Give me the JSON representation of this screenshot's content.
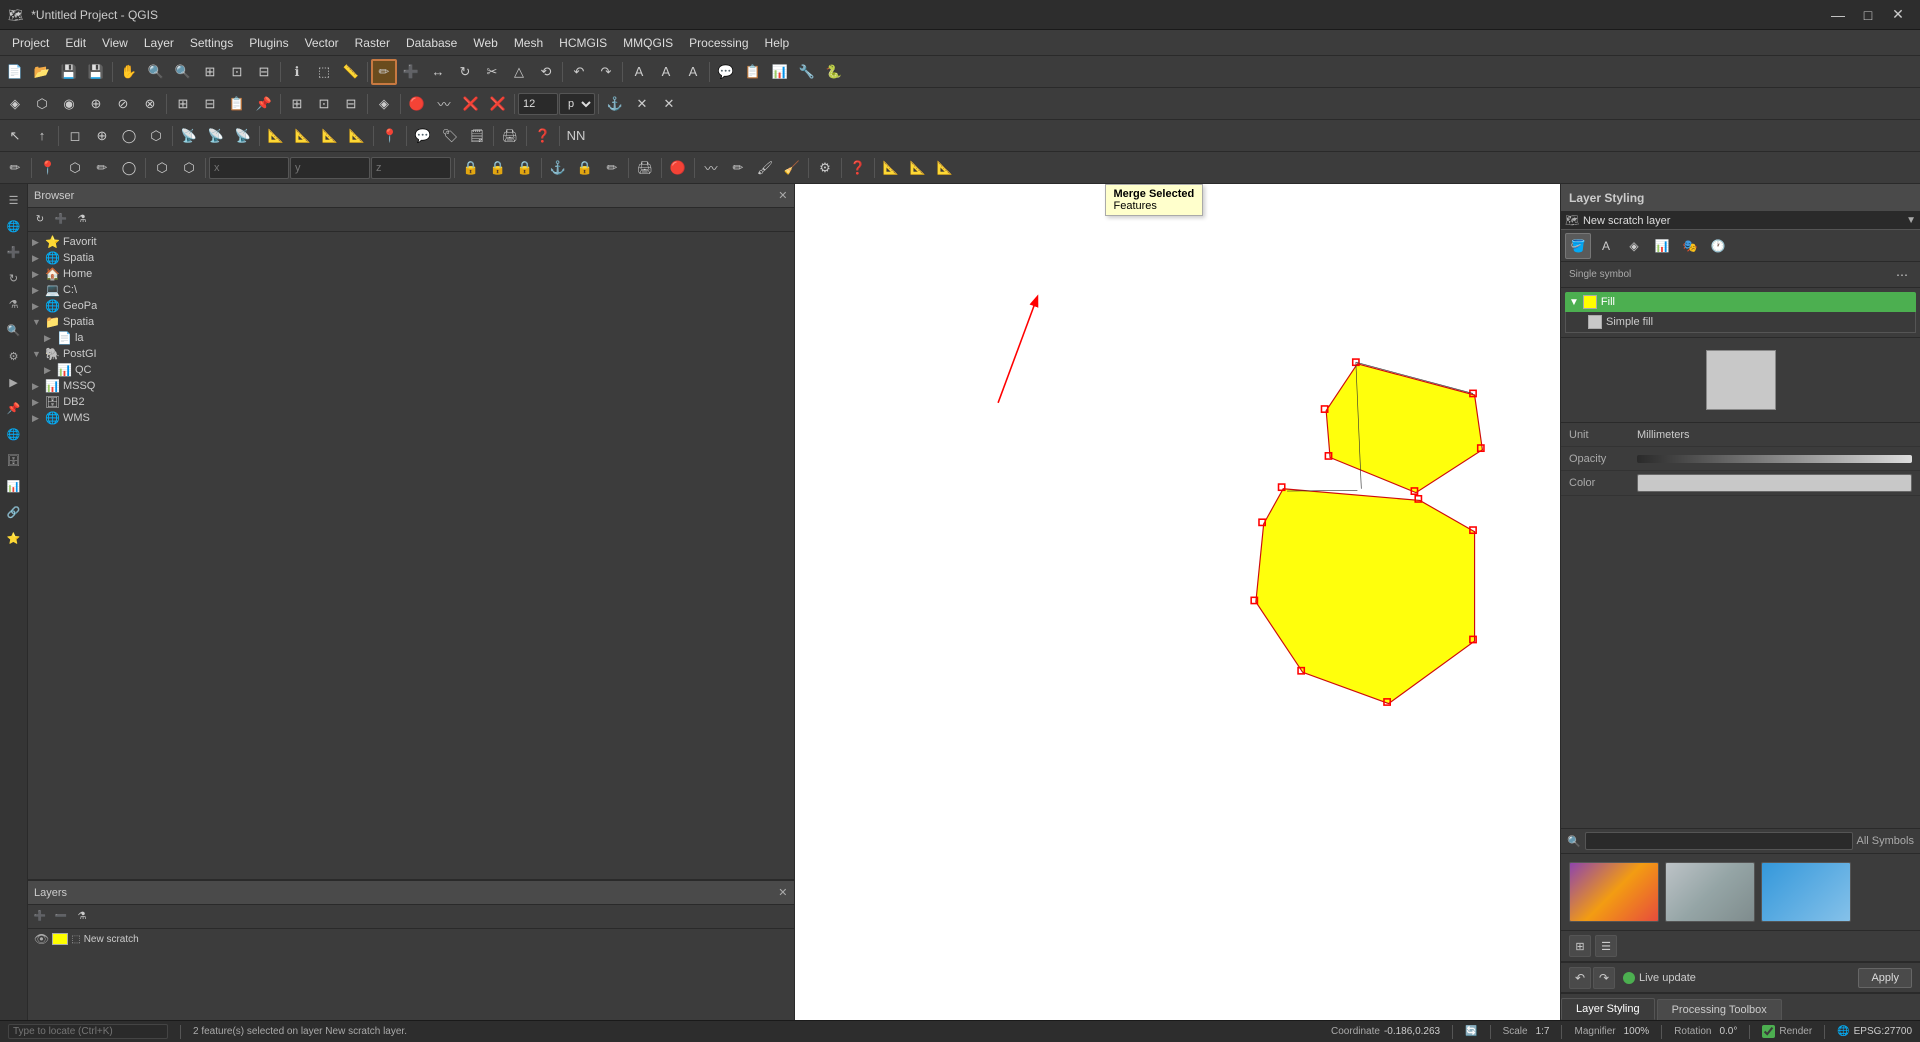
{
  "titlebar": {
    "title": "*Untitled Project - QGIS",
    "icon": "🗺",
    "minimize": "—",
    "maximize": "□",
    "close": "✕"
  },
  "menubar": {
    "items": [
      "Project",
      "Edit",
      "View",
      "Layer",
      "Settings",
      "Plugins",
      "Vector",
      "Raster",
      "Database",
      "Web",
      "Mesh",
      "HCMGIS",
      "MMQGIS",
      "Processing",
      "Help"
    ]
  },
  "tooltip": {
    "label": "Merge Selected\nFeatures"
  },
  "browser": {
    "title": "Browser",
    "items": [
      {
        "icon": "⭐",
        "label": "Favorit",
        "expand": "▶"
      },
      {
        "icon": "🌐",
        "label": "Spatia",
        "expand": "▶"
      },
      {
        "icon": "🏠",
        "label": "Home",
        "expand": "▶"
      },
      {
        "icon": "💻",
        "label": "C:\\",
        "expand": "▶"
      },
      {
        "icon": "🌐",
        "label": "GeoPa",
        "expand": "▶"
      },
      {
        "icon": "📁",
        "label": "Spatia",
        "expand": "▼"
      },
      {
        "icon": "📄",
        "label": "la",
        "expand": "▶",
        "indent": 12
      },
      {
        "icon": "🐘",
        "label": "PostGI",
        "expand": "▼"
      },
      {
        "icon": "📊",
        "label": "QC",
        "expand": "▶",
        "indent": 12
      },
      {
        "icon": "📊",
        "label": "MSSQ",
        "expand": "▶"
      },
      {
        "icon": "🗄",
        "label": "DB2",
        "expand": "▶"
      },
      {
        "icon": "🌐",
        "label": "WMS",
        "expand": "▶"
      }
    ]
  },
  "layers": {
    "title": "Layers",
    "items": [
      {
        "visible": true,
        "name": "New scratch layer",
        "type": "polygon"
      }
    ]
  },
  "layer_styling": {
    "title": "Layer Styling",
    "layer_name": "New scratch layer",
    "symbol_type": "Single symbol",
    "fill_label": "Fill",
    "simple_fill_label": "Simple fill",
    "unit_label": "Unit",
    "unit_value": "Millimeters",
    "opacity_label": "Opacity",
    "color_label": "Color",
    "all_symbols_label": "All Symbols",
    "all_symbols_search": "All Symbols",
    "live_update_label": "Live update",
    "apply_label": "Apply"
  },
  "bottom_tabs": [
    {
      "label": "Layer Styling",
      "active": true
    },
    {
      "label": "Processing Toolbox",
      "active": false
    }
  ],
  "statusbar": {
    "selected_info": "2 feature(s) selected on layer New scratch layer.",
    "locate_placeholder": "Type to locate (Ctrl+K)",
    "coordinate_label": "Coordinate",
    "coordinate_value": "-0.186,0.263",
    "scale_label": "Scale",
    "scale_value": "1:7",
    "magnifier_label": "Magnifier",
    "magnifier_value": "100%",
    "rotation_label": "Rotation",
    "rotation_value": "0.0°",
    "render_label": "Render",
    "epsg_label": "EPSG:27700"
  },
  "toolbar_rows": {
    "row1_hint": "main toolbars",
    "px_value": "12",
    "px_unit": "px"
  }
}
